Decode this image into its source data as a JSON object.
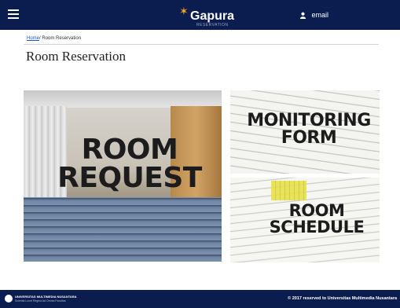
{
  "header": {
    "logo_text": "Gapura",
    "logo_subtitle": "RESERVATION",
    "user_label": "email"
  },
  "breadcrumb": {
    "home": "Home",
    "separator": "/",
    "current": "Room Reservation"
  },
  "page_title": "Room Reservation",
  "tiles": {
    "room_request": {
      "line1": "ROOM",
      "line2": "REQUEST"
    },
    "monitoring_form": {
      "line1": "MONITORING",
      "line2": "FORM"
    },
    "room_schedule": {
      "line1": "ROOM",
      "line2": "SCHEDULE"
    }
  },
  "footer": {
    "university": "UNIVERSITAS MULTIMEDIA NUSANTARA",
    "tagline": "Scientia Lucet Regina Ad Omnia Facultas",
    "copyright": "© 2017 reserved to Universitas Multimedia Nusantara"
  },
  "colors": {
    "navbar": "#0b1d4f",
    "link": "#1a56c7"
  }
}
